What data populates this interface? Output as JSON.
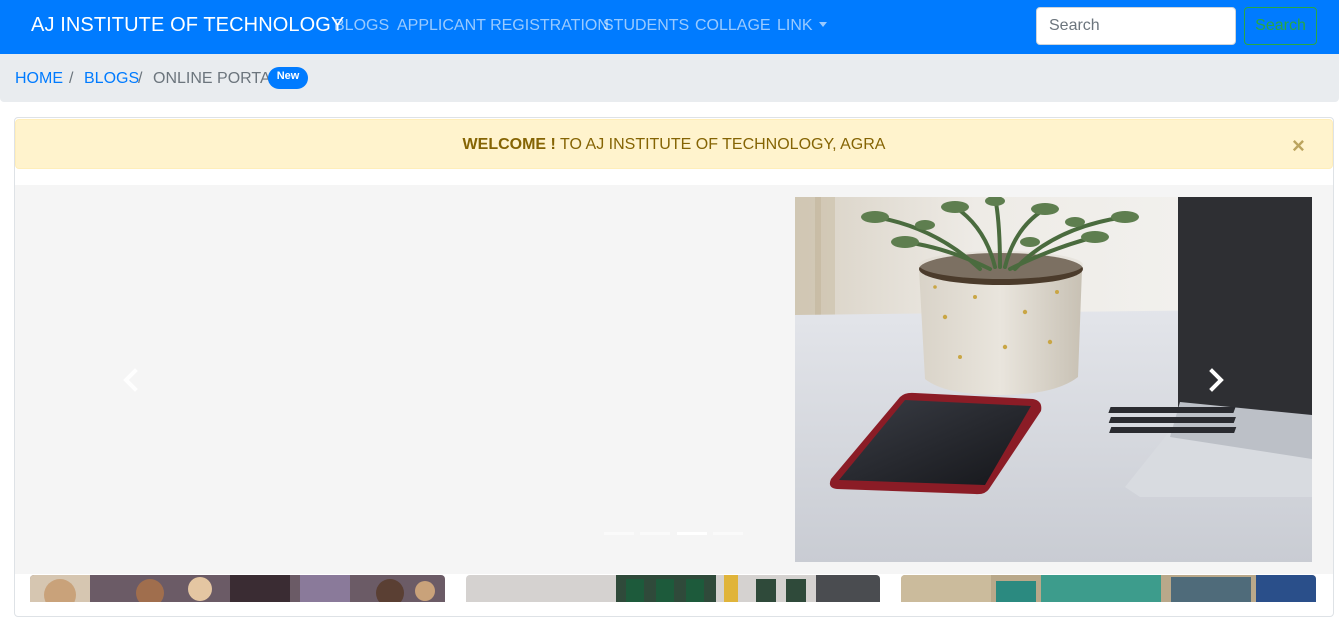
{
  "navbar": {
    "brand": "AJ INSTITUTE OF TECHNOLOGY",
    "links": [
      "BLOGS",
      "APPLICANT REGISTRATION",
      "STUDENTS",
      "COLLAGE",
      "LINK"
    ],
    "search_placeholder": "Search",
    "search_button": "Search"
  },
  "breadcrumb": {
    "home": "HOME",
    "blogs": "BLOGS",
    "current": "ONLINE PORTAL",
    "separator": "/",
    "badge": "New"
  },
  "alert": {
    "strong": "WELCOME !",
    "text": " TO AJ INSTITUTE OF TECHNOLOGY, AGRA",
    "close": "×"
  },
  "carousel": {
    "slide_count": 4,
    "active_index": 2,
    "prev_icon": "chevron-left-icon",
    "next_icon": "chevron-right-icon"
  },
  "colors": {
    "primary": "#007bff",
    "success_outline": "#28a745",
    "alert_bg": "#fff3cd",
    "alert_text": "#856404",
    "breadcrumb_bg": "#e9ecef"
  }
}
